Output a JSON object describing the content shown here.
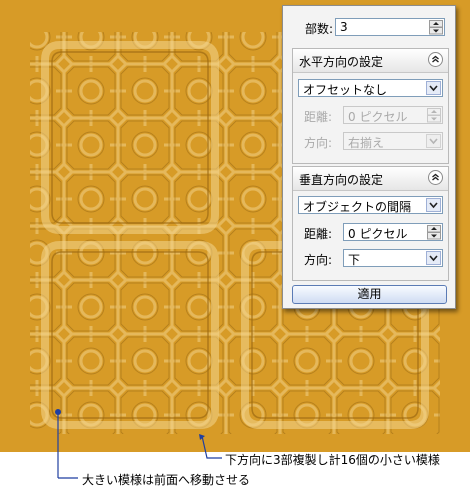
{
  "panel": {
    "copies_label": "部数:",
    "copies_value": "3",
    "horizontal": {
      "title": "水平方向の設定",
      "mode": "オフセットなし",
      "distance_label": "距離:",
      "distance_value": "0 ピクセル",
      "direction_label": "方向:",
      "direction_value": "右揃え"
    },
    "vertical": {
      "title": "垂直方向の設定",
      "mode": "オブジェクトの間隔",
      "distance_label": "距離:",
      "distance_value": "0 ピクセル",
      "direction_label": "方向:",
      "direction_value": "下"
    },
    "apply_label": "適用"
  },
  "annotations": {
    "small_pattern": "下方向に3部複製し計16個の小さい模様",
    "large_pattern": "大きい模様は前面へ移動させる"
  },
  "colors": {
    "canvas": "#d79b27",
    "accent": "#1f3fa0"
  }
}
